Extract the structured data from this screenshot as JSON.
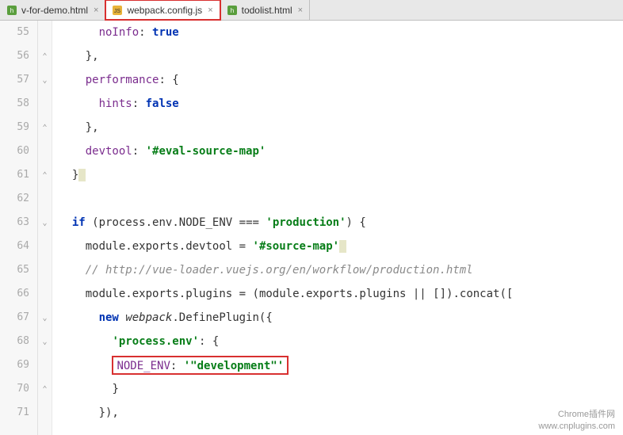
{
  "tabs": [
    {
      "label": "v-for-demo.html",
      "icon": "html",
      "active": false
    },
    {
      "label": "webpack.config.js",
      "icon": "js",
      "active": true,
      "highlighted": true
    },
    {
      "label": "todolist.html",
      "icon": "html",
      "active": false
    }
  ],
  "lines": {
    "start": 55,
    "end": 71
  },
  "code": {
    "l55": {
      "key": "noInfo",
      "val": "true"
    },
    "l57": {
      "key": "performance"
    },
    "l58": {
      "key": "hints",
      "val": "false"
    },
    "l60": {
      "key": "devtool",
      "val": "'#eval-source-map'"
    },
    "l63": {
      "if": "if",
      "obj": "process",
      "p1": "env",
      "p2": "NODE_ENV",
      "op": "===",
      "str": "'production'"
    },
    "l64": {
      "o1": "module",
      "p1": "exports",
      "p2": "devtool",
      "str": "'#source-map'"
    },
    "l65": {
      "comment": "// http://vue-loader.vuejs.org/en/workflow/production.html"
    },
    "l66": {
      "o1": "module",
      "p1": "exports",
      "p2": "plugins",
      "o2": "module",
      "p3": "exports",
      "p4": "plugins",
      "concat": "concat"
    },
    "l67": {
      "new": "new",
      "obj": "webpack",
      "fn": "DefinePlugin"
    },
    "l68": {
      "key": "'process.env'"
    },
    "l69": {
      "key": "NODE_ENV",
      "val": "'\"development\"'"
    }
  },
  "watermark": {
    "l1": "Chrome插件网",
    "l2": "www.cnplugins.com"
  }
}
